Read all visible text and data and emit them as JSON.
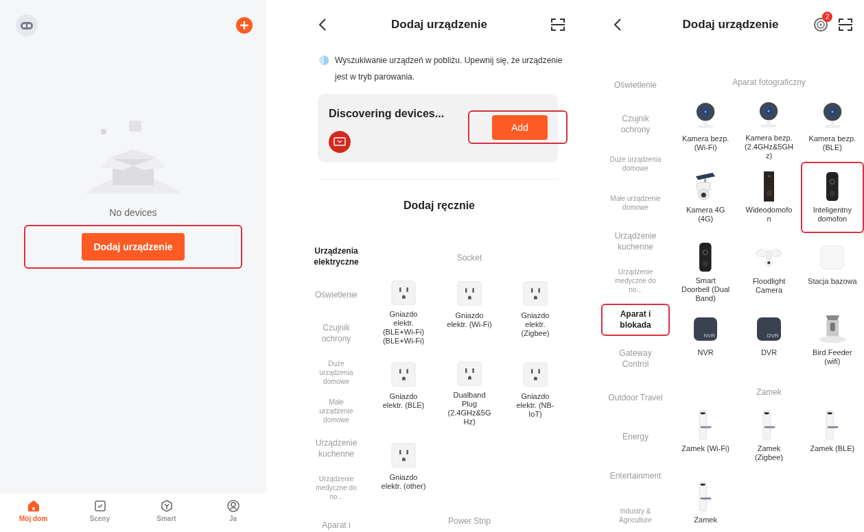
{
  "home": {
    "empty_text": "No devices",
    "add_button": {
      "label": "Dodaj urządzenie",
      "highlighted": true
    },
    "tabs": [
      {
        "label": "Mój dom",
        "selected": true
      },
      {
        "label": "Sceny",
        "selected": false
      },
      {
        "label": "Smart",
        "selected": false
      },
      {
        "label": "Ja",
        "selected": false
      }
    ]
  },
  "add_device": {
    "title": "Dodaj urządzenie",
    "info": "Wyszukiwanie urządzeń w pobliżu. Upewnij się, że urządzenie jest w tryb parowania.",
    "discovery": {
      "title": "Discovering devices...",
      "button": {
        "label": "Add",
        "highlighted": true
      }
    },
    "manual_heading": "Dodaj ręcznie",
    "categories": [
      {
        "label": "Urządzenia elektryczne",
        "selected": true,
        "highlighted": false
      },
      {
        "label": "Oświetlenie",
        "selected": false,
        "highlighted": false
      },
      {
        "label": "Czujnik ochrony",
        "selected": false,
        "highlighted": false
      },
      {
        "label": "Duże urządzenia domowe",
        "selected": false,
        "highlighted": false
      },
      {
        "label": "Małe urządzenie domowe",
        "selected": false,
        "highlighted": false
      },
      {
        "label": "Urządzenie kuchenne",
        "selected": false,
        "highlighted": false
      },
      {
        "label": "Urządzenie medyczne do no...",
        "selected": false,
        "highlighted": false
      },
      {
        "label": "Aparat i",
        "selected": false,
        "highlighted": false
      }
    ],
    "groups": [
      {
        "heading": "Socket",
        "devices": [
          {
            "label": "Gniazdo elektr. (BLE+Wi-Fi) (BLE+Wi-Fi)",
            "kind": "socket",
            "highlighted": false
          },
          {
            "label": "Gniazdo elektr. (Wi-Fi)",
            "kind": "socket",
            "highlighted": false
          },
          {
            "label": "Gniazdo elektr. (Zigbee)",
            "kind": "socket",
            "highlighted": false
          },
          {
            "label": "Gniazdo elektr. (BLE)",
            "kind": "socket",
            "highlighted": false
          },
          {
            "label": "Dualband Plug (2.4GHz&5GHz)",
            "kind": "socket",
            "highlighted": false
          },
          {
            "label": "Gniazdo elektr. (NB-IoT)",
            "kind": "socket",
            "highlighted": false
          },
          {
            "label": "Gniazdo elektr. (other)",
            "kind": "socket",
            "highlighted": false
          }
        ]
      },
      {
        "heading": "Power Strip"
      }
    ]
  },
  "category_screen": {
    "title": "Dodaj urządzenie",
    "notification_count": "2",
    "categories": [
      {
        "label": "Oświetlenie",
        "selected": false,
        "highlighted": false
      },
      {
        "label": "Czujnik ochrony",
        "selected": false,
        "highlighted": false
      },
      {
        "label": "Duże urządzenia domowe",
        "selected": false,
        "highlighted": false
      },
      {
        "label": "Małe urządzenie domowe",
        "selected": false,
        "highlighted": false
      },
      {
        "label": "Urządzenie kuchenne",
        "selected": false,
        "highlighted": false
      },
      {
        "label": "Urządzenie medyczne do no...",
        "selected": false,
        "highlighted": false
      },
      {
        "label": "Aparat i blokada",
        "selected": true,
        "highlighted": true
      },
      {
        "label": "Gateway Control",
        "selected": false,
        "highlighted": false
      },
      {
        "label": "Outdoor Travel",
        "selected": false,
        "highlighted": false
      },
      {
        "label": "Energy",
        "selected": false,
        "highlighted": false
      },
      {
        "label": "Entertainment",
        "selected": false,
        "highlighted": false
      },
      {
        "label": "Industry & Agriculture",
        "selected": false,
        "highlighted": false
      }
    ],
    "groups": [
      {
        "heading": "Aparat fotograficzny",
        "devices": [
          {
            "label": "Kamera bezp. (Wi-Fi)",
            "kind": "camera",
            "highlighted": false
          },
          {
            "label": "Kamera bezp. (2.4GHz&5GHz)",
            "kind": "camera",
            "highlighted": false
          },
          {
            "label": "Kamera bezp. (BLE)",
            "kind": "camera",
            "highlighted": false
          },
          {
            "label": "Kamera 4G (4G)",
            "kind": "solar-camera",
            "highlighted": false
          },
          {
            "label": "Wideodomofon",
            "kind": "video-intercom",
            "highlighted": false
          },
          {
            "label": "Inteligentny domofon",
            "kind": "doorbell",
            "highlighted": true
          },
          {
            "label": "Smart Doorbell (Dual Band)",
            "kind": "doorbell",
            "highlighted": false
          },
          {
            "label": "Floodlight Camera",
            "kind": "floodlight",
            "highlighted": false
          },
          {
            "label": "Stacja bazowa",
            "kind": "base-station",
            "highlighted": false
          },
          {
            "label": "NVR",
            "kind": "recorder",
            "icon_text": "NVR",
            "highlighted": false
          },
          {
            "label": "DVR",
            "kind": "recorder",
            "icon_text": "DVR",
            "highlighted": false
          },
          {
            "label": "Bird Feeder (wifi)",
            "kind": "bird-feeder",
            "highlighted": false
          }
        ]
      },
      {
        "heading": "Zamek",
        "devices": [
          {
            "label": "Zamek (Wi-Fi)",
            "kind": "lock",
            "highlighted": false
          },
          {
            "label": "Zamek (Zigbee)",
            "kind": "lock",
            "highlighted": false
          },
          {
            "label": "Zamek (BLE)",
            "kind": "lock",
            "highlighted": false
          },
          {
            "label": "Zamek",
            "kind": "lock",
            "highlighted": false
          }
        ]
      }
    ]
  }
}
